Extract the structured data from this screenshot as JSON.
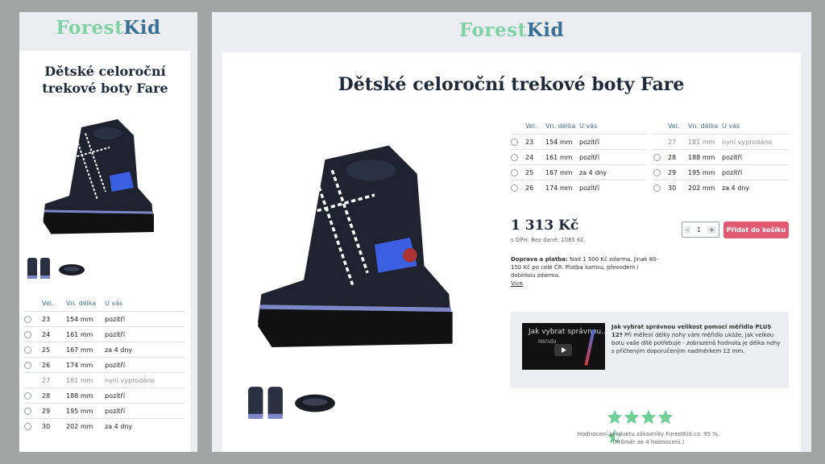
{
  "brand": {
    "part1": "Forest",
    "part2": "Kid"
  },
  "product": {
    "title": "Dětské celoroční trekové boty Fare",
    "title_line1": "Dětské celoroční",
    "title_line2": "trekové boty Fare",
    "price": "1 313 Kč",
    "price_note": "s DPH. Bez daně: 1085 Kč.",
    "quantity": "1",
    "add_to_cart": "Přidat do košíku",
    "qty_minus": "-",
    "qty_plus": "+"
  },
  "size_table": {
    "headers": [
      "Vel.",
      "Vn. délka",
      "U vás"
    ],
    "rows": [
      {
        "size": "23",
        "length": "154 mm",
        "availability": "pozítří",
        "sold_out": false
      },
      {
        "size": "24",
        "length": "161 mm",
        "availability": "pozítří",
        "sold_out": false
      },
      {
        "size": "25",
        "length": "167 mm",
        "availability": "za 4 dny",
        "sold_out": false
      },
      {
        "size": "26",
        "length": "174 mm",
        "availability": "pozítří",
        "sold_out": false
      },
      {
        "size": "27",
        "length": "181 mm",
        "availability": "nyní vyprodáno",
        "sold_out": true
      },
      {
        "size": "28",
        "length": "188 mm",
        "availability": "pozítří",
        "sold_out": false
      },
      {
        "size": "29",
        "length": "195 mm",
        "availability": "pozítří",
        "sold_out": false
      },
      {
        "size": "30",
        "length": "202 mm",
        "availability": "za 4 dny",
        "sold_out": false
      }
    ]
  },
  "shipping": {
    "label": "Doprava a platba:",
    "text": "Nad 1 500 Kč zdarma. Jinak 80-150 Kč po celé ČR. Platba kartou, převodem i dobírkou zdarma.",
    "more": "Více"
  },
  "video": {
    "thumb_title": "Jak vybrat správnou...",
    "thumb_sub": "Měřidlo",
    "heading": "Jak vybrat správnou velikost pomocí měřidla PLUS 12?",
    "text": "Při měření délky nohy vám měřidlo ukáže, jak velkou botu vaše dítě potřebuje - zobrazená hodnota je délka nohy s přičteným doporučeným nadměrkem 12 mm."
  },
  "rating": {
    "stars": 4.5,
    "max": 5,
    "line1": "Hodnocení produktu zákazníky ForestKid.cz: 95 %.",
    "line2": "(Průměr ze 4 hodnocení.)",
    "color": "#6fcf97"
  },
  "colors": {
    "brand_green": "#7fd1a6",
    "brand_blue": "#3a6f97",
    "cart_button": "#e05a74",
    "title": "#1e2a3a"
  }
}
